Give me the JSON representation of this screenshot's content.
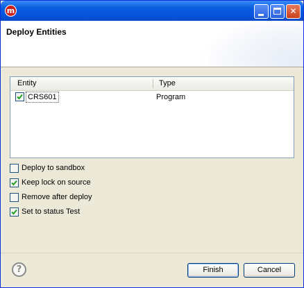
{
  "window": {
    "app_icon_glyph": "m",
    "app_icon": "app-logo-icon"
  },
  "titlebar_buttons": {
    "minimize_icon": "minimize-icon",
    "maximize_icon": "maximize-icon",
    "close_glyph": "✕"
  },
  "header": {
    "title": "Deploy Entities"
  },
  "table": {
    "columns": [
      "Entity",
      "Type"
    ],
    "rows": [
      {
        "entity": "CRS601",
        "type": "Program",
        "checked": true
      }
    ]
  },
  "options": [
    {
      "label": "Deploy to sandbox",
      "checked": false
    },
    {
      "label": "Keep lock on source",
      "checked": true
    },
    {
      "label": "Remove after deploy",
      "checked": false
    },
    {
      "label": "Set to status Test",
      "checked": true
    }
  ],
  "footer": {
    "help_glyph": "?",
    "finish_label": "Finish",
    "cancel_label": "Cancel"
  }
}
